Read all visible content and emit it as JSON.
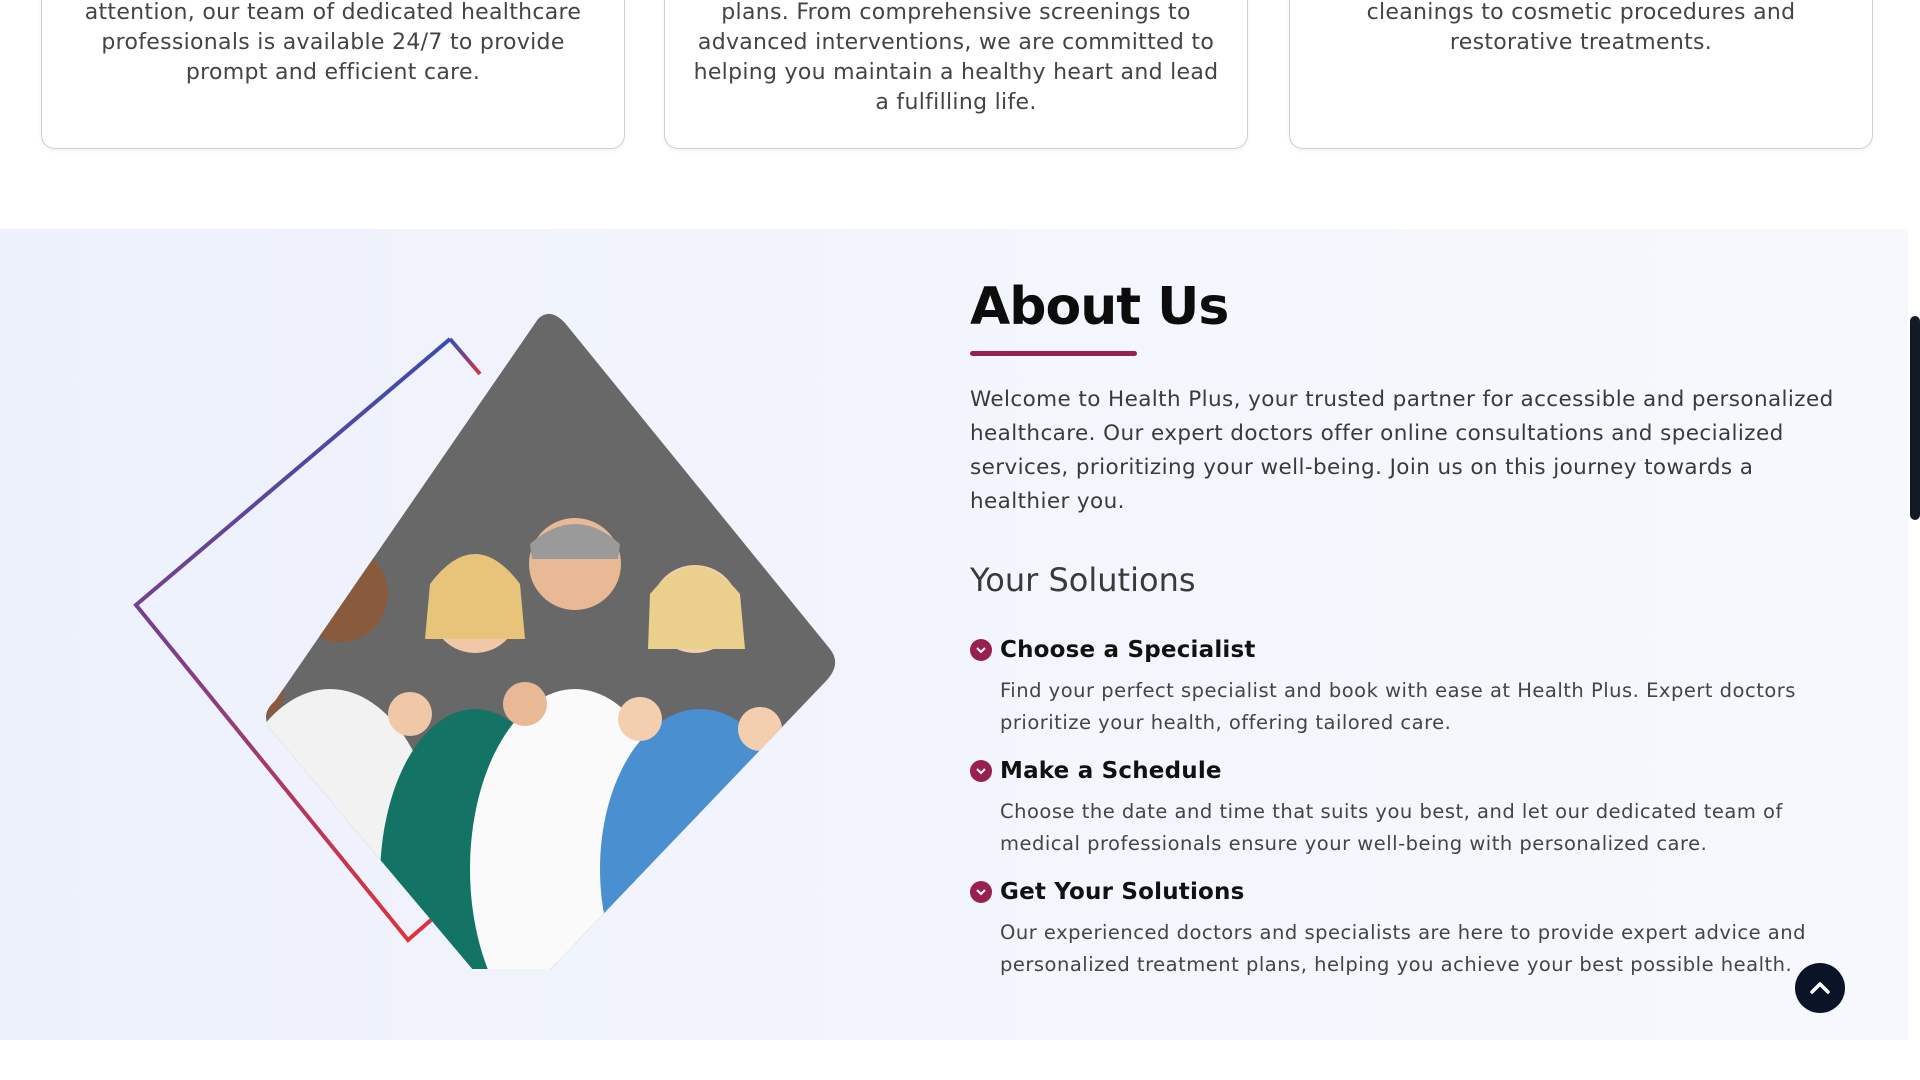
{
  "cards": [
    {
      "text": "attention, our team of dedicated healthcare professionals is available 24/7 to provide prompt and efficient care."
    },
    {
      "text": "plans. From comprehensive screenings to advanced interventions, we are committed to helping you maintain a healthy heart and lead a fulfilling life."
    },
    {
      "text": "cleanings to cosmetic procedures and restorative treatments."
    }
  ],
  "about": {
    "title": "About Us",
    "intro": "Welcome to Health Plus, your trusted partner for accessible and personalized healthcare. Our expert doctors offer online consultations and specialized services, prioritizing your well-being. Join us on this journey towards a healthier you.",
    "subtitle": "Your Solutions",
    "solutions": [
      {
        "title": "Choose a Specialist",
        "desc": "Find your perfect specialist and book with ease at Health Plus. Expert doctors prioritize your health, offering tailored care."
      },
      {
        "title": "Make a Schedule",
        "desc": "Choose the date and time that suits you best, and let our dedicated team of medical professionals ensure your well-being with personalized care."
      },
      {
        "title": "Get Your Solutions",
        "desc": "Our experienced doctors and specialists are here to provide expert advice and personalized treatment plans, helping you achieve your best possible health."
      }
    ]
  },
  "icons": {
    "check": "check-circle-icon",
    "scroll_top": "chevron-up-icon"
  },
  "colors": {
    "accent": "#97204f",
    "section_bg": "#f0f3fc",
    "scroll_button": "#0a1426",
    "frame_gradient_start": "#3a4bb3",
    "frame_gradient_end": "#e0323a"
  }
}
